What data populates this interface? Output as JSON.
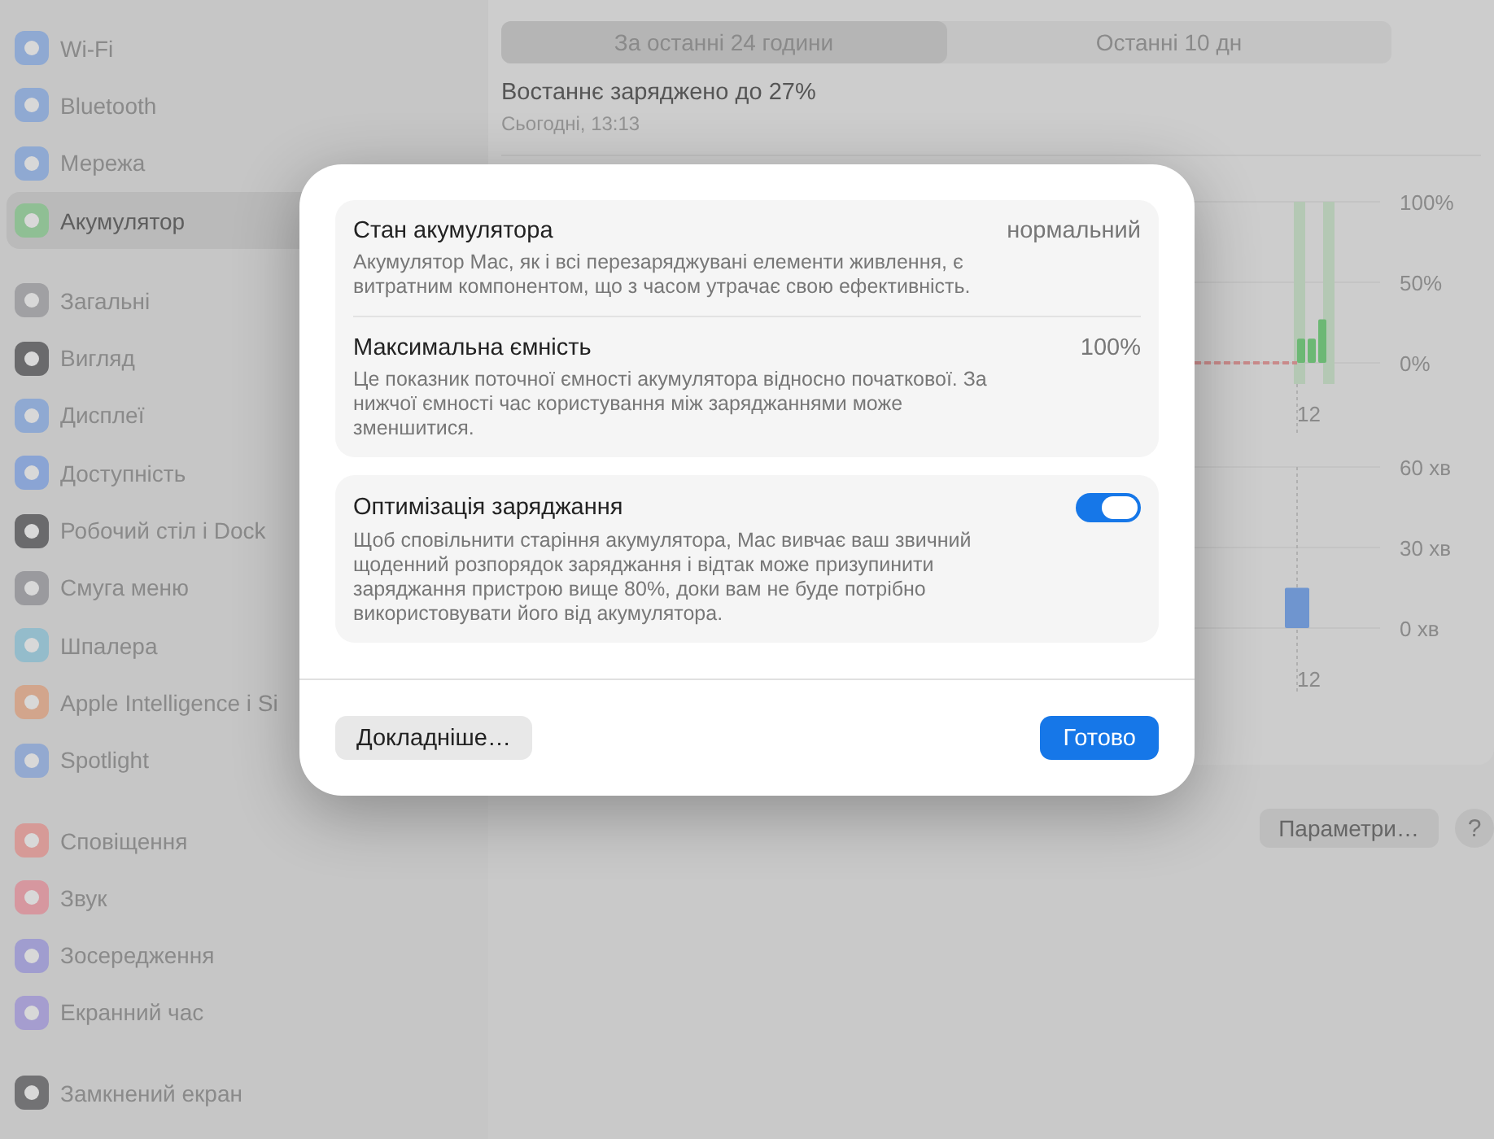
{
  "sidebar": {
    "groups": [
      {
        "items": [
          {
            "label": "Wi-Fi",
            "color": "#8fa9d2",
            "selected": false
          },
          {
            "label": "Bluetooth",
            "color": "#8fa9d2",
            "selected": false
          },
          {
            "label": "Мережа",
            "color": "#8fa9d2",
            "selected": false
          },
          {
            "label": "Акумулятор",
            "color": "#8fbf94",
            "selected": true
          }
        ]
      },
      {
        "items": [
          {
            "label": "Загальні",
            "color": "#a0a0a3",
            "selected": false
          },
          {
            "label": "Вигляд",
            "color": "#6a6a6c",
            "selected": false
          },
          {
            "label": "Дисплеї",
            "color": "#8fa9d2",
            "selected": false
          },
          {
            "label": "Доступність",
            "color": "#8aa4d4",
            "selected": false
          },
          {
            "label": "Робочий стіл і Dock",
            "color": "#6a6a6c",
            "selected": false
          },
          {
            "label": "Смуга меню",
            "color": "#9a9a9e",
            "selected": false
          },
          {
            "label": "Шпалера",
            "color": "#94bccb",
            "selected": false
          },
          {
            "label": "Apple Intelligence і Si",
            "color": "#d2a58c",
            "selected": false
          },
          {
            "label": "Spotlight",
            "color": "#93a9d0",
            "selected": false
          }
        ]
      },
      {
        "items": [
          {
            "label": "Сповіщення",
            "color": "#d69a97",
            "selected": false
          },
          {
            "label": "Звук",
            "color": "#d6979f",
            "selected": false
          },
          {
            "label": "Зосередження",
            "color": "#a09dcf",
            "selected": false
          },
          {
            "label": "Екранний час",
            "color": "#a59dcf",
            "selected": false
          }
        ]
      },
      {
        "items": [
          {
            "label": "Замкнений екран",
            "color": "#727274",
            "selected": false
          }
        ]
      }
    ]
  },
  "main": {
    "tabs": [
      {
        "label": "За останні 24 години",
        "selected": true
      },
      {
        "label": "Останні 10 дн",
        "selected": false
      }
    ],
    "last_charge": {
      "title": "Востаннє заряджено до 27%",
      "time": "Сьогодні, 13:13"
    },
    "level_chart": {
      "chart_data": {
        "type": "bar",
        "categories": [
          "12"
        ],
        "series": [
          {
            "color": "#6cb874",
            "values": [
              15
            ]
          },
          {
            "color": "#6cb874",
            "values": [
              15
            ]
          },
          {
            "color": "#6cb874",
            "values": [
              27
            ]
          }
        ],
        "ylim": [
          0,
          100
        ],
        "yticks": [
          {
            "value": 100,
            "label": "100%"
          },
          {
            "value": 50,
            "label": "50%"
          },
          {
            "value": 0,
            "label": "0%"
          }
        ]
      }
    },
    "activity_chart": {
      "chart_data": {
        "type": "bar",
        "categories": [
          "12"
        ],
        "series": [
          {
            "color": "#6f95cf",
            "values": [
              15
            ]
          }
        ],
        "ylim": [
          0,
          60
        ],
        "yticks": [
          {
            "value": 60,
            "label": "60 хв"
          },
          {
            "value": 30,
            "label": "30 хв"
          },
          {
            "value": 0,
            "label": "0 хв"
          }
        ]
      }
    },
    "buttons": [
      {
        "label": "Параметри…",
        "kind": "pill"
      },
      {
        "label": "?",
        "kind": "round"
      }
    ]
  },
  "dialog": {
    "groups": [
      {
        "rows": [
          {
            "kind": "value",
            "title": "Стан акумулятора",
            "value": "нормальний",
            "description": "Акумулятор Mac, як і всі перезаряджувані елементи живлення, є витратним компонентом, що з часом утрачає свою ефективність."
          },
          {
            "kind": "value",
            "title": "Максимальна ємність",
            "value": "100%",
            "description": "Це показник поточної ємності акумулятора відносно початкової. За нижчої ємності час користування між заряджаннями може зменшитися."
          }
        ]
      },
      {
        "rows": [
          {
            "kind": "toggle",
            "title": "Оптимізація заряджання",
            "on": true,
            "description": "Щоб сповільнити старіння акумулятора, Mac вивчає ваш звичний щоденний розпорядок заряджання і відтак може призупинити заряджання пристрою вище 80%, доки вам не буде потрібно використовувати його від акумулятора."
          }
        ]
      }
    ],
    "buttons": [
      {
        "label": "Докладніше…",
        "kind": "secondary"
      },
      {
        "label": "Готово",
        "kind": "primary"
      }
    ]
  }
}
